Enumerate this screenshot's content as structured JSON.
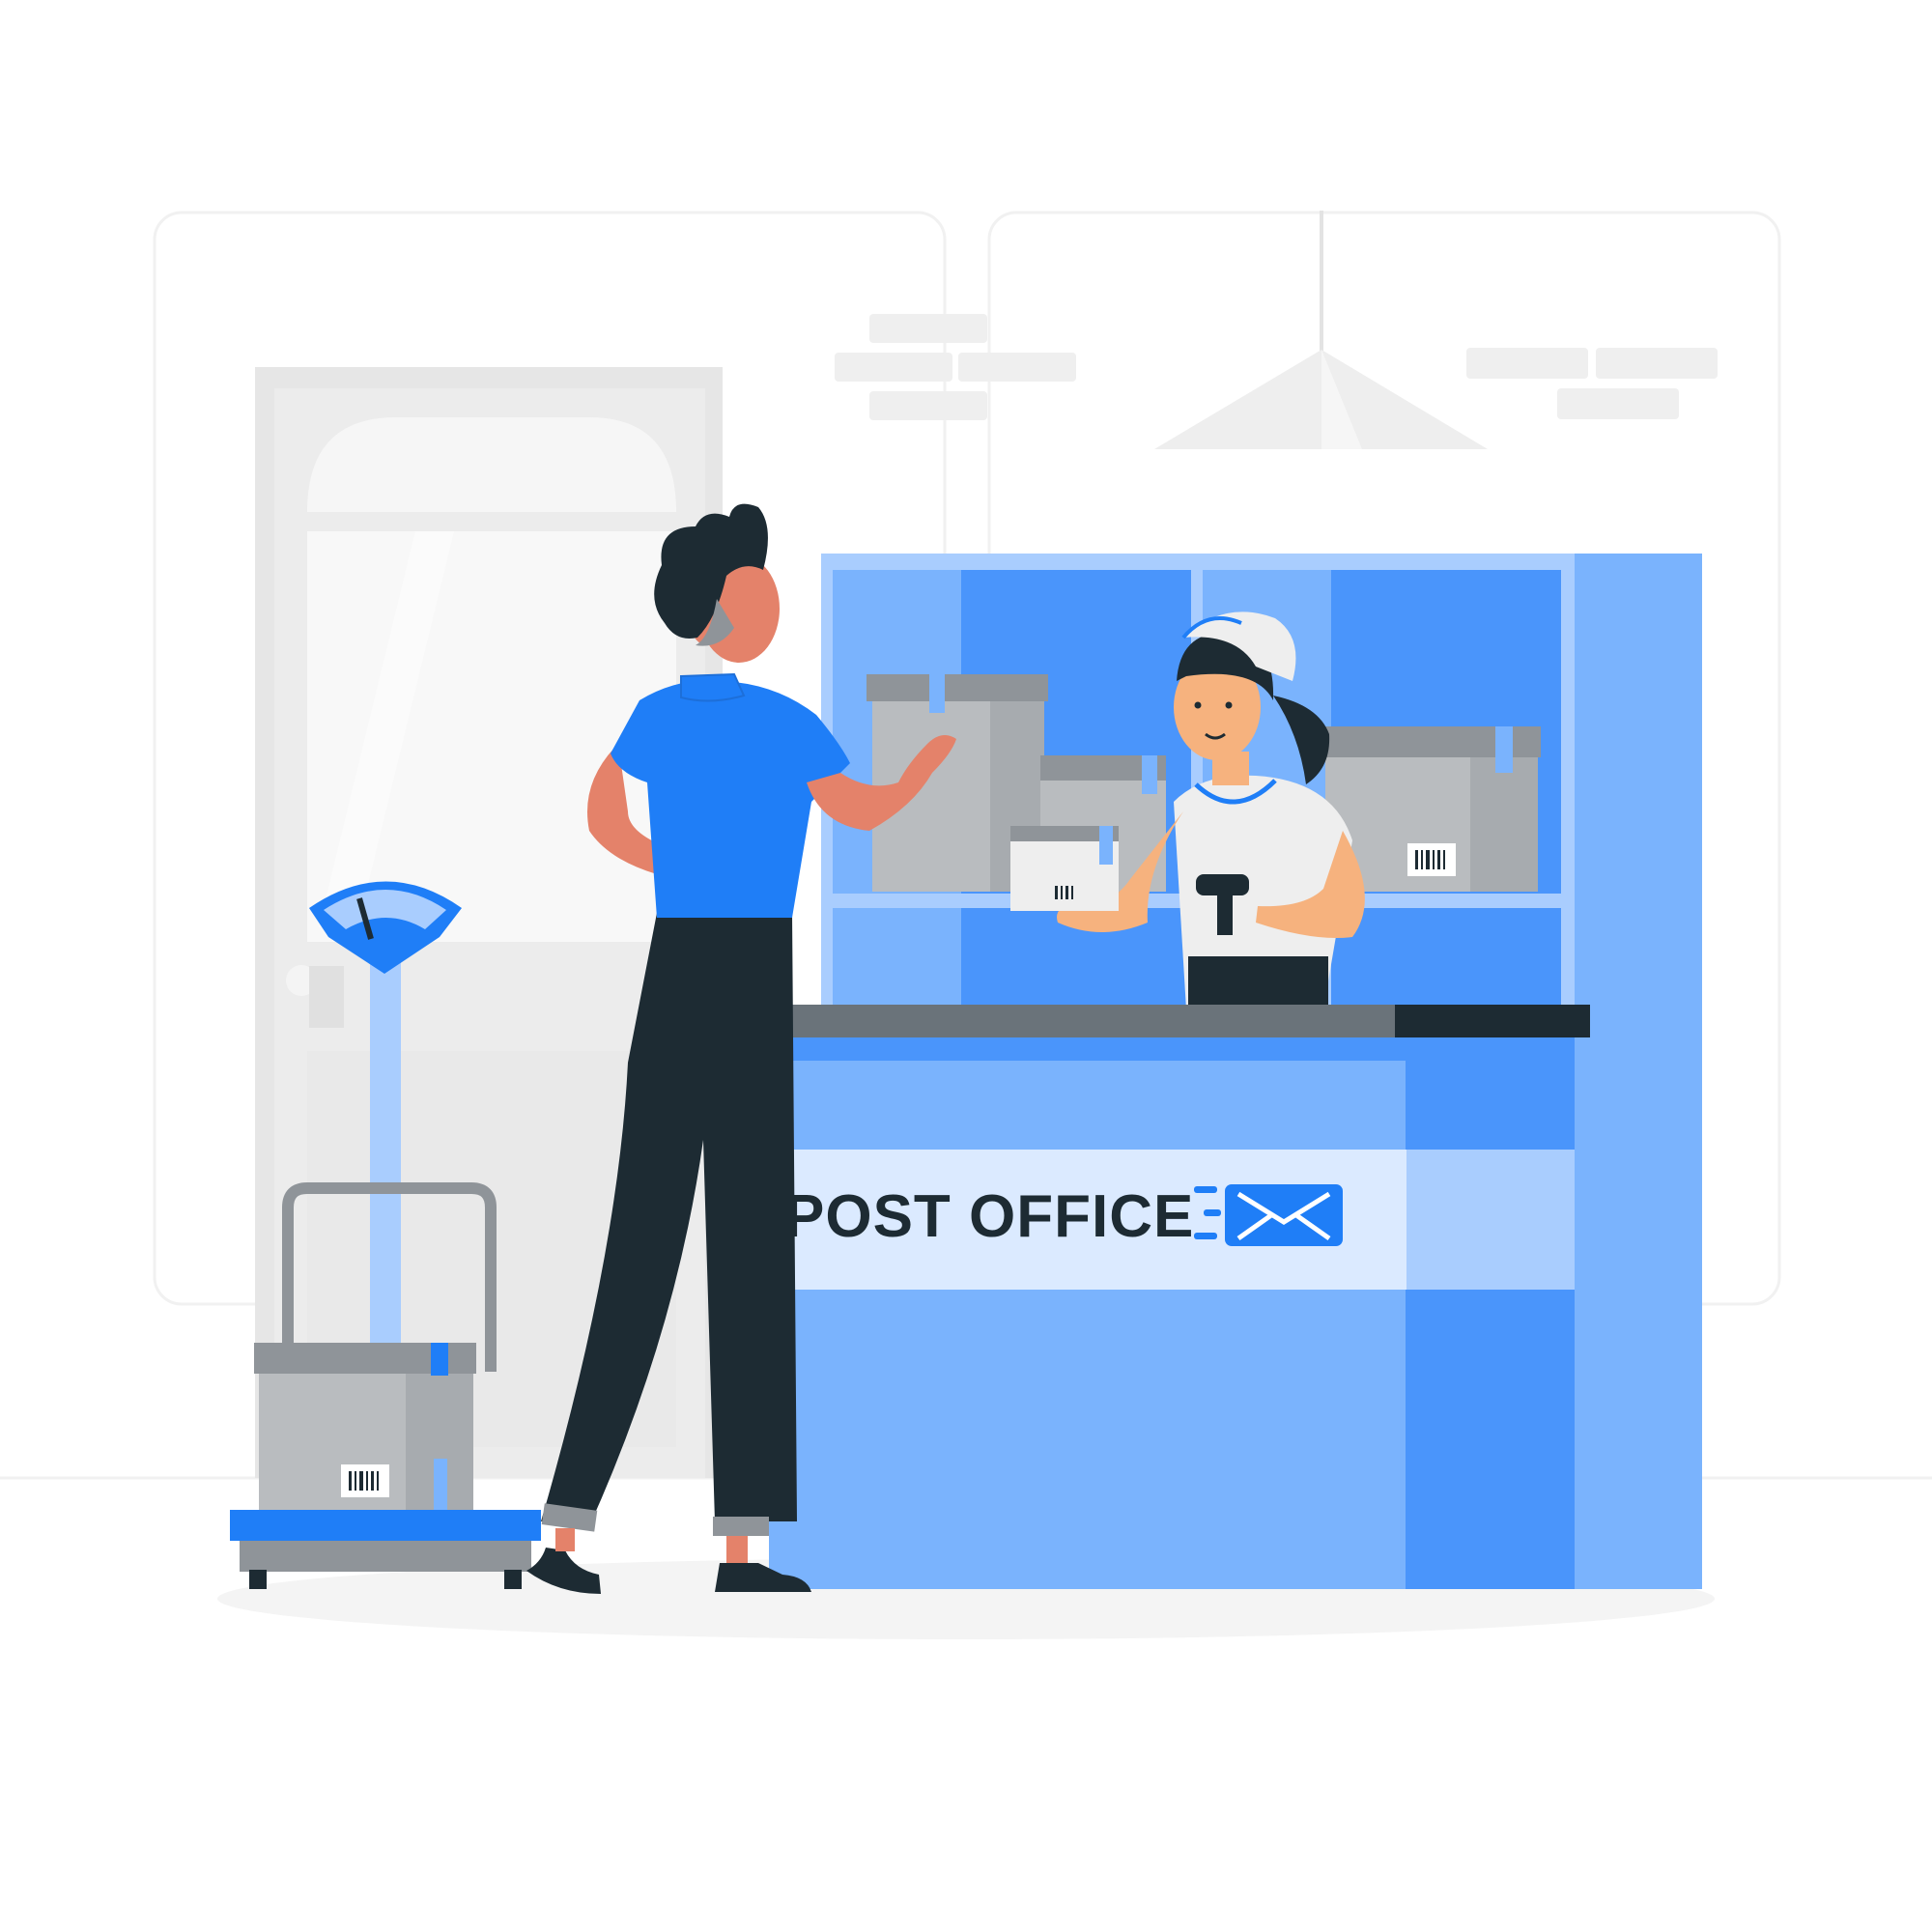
{
  "scene": {
    "counter_sign": "POST OFFICE",
    "colors": {
      "background": "#ffffff",
      "wall_outline": "#f1f1f1",
      "brick": "#efefef",
      "door": "#e6e6e6",
      "door_light": "#f4f4f4",
      "blue_primary": "#1f7ef7",
      "blue_mid": "#4a95fb",
      "blue_light": "#7ab3fd",
      "blue_pale": "#a9cdfe",
      "blue_sign": "#dbeaff",
      "counter_top": "#6a737a",
      "counter_top_dark": "#1d2b33",
      "box_gray": "#b9bcbf",
      "box_gray_dark": "#8f9499",
      "skin": "#e4826a",
      "skin_woman": "#f6b27e",
      "hair": "#1d2b33",
      "pants": "#1d2b33",
      "shirt_white": "#eeeeee",
      "shadow": "#f4f4f4"
    },
    "icons": [
      "envelope-icon",
      "barcode-icon",
      "scale-dial-icon",
      "ceiling-lamp-icon",
      "barcode-scanner-icon"
    ]
  }
}
